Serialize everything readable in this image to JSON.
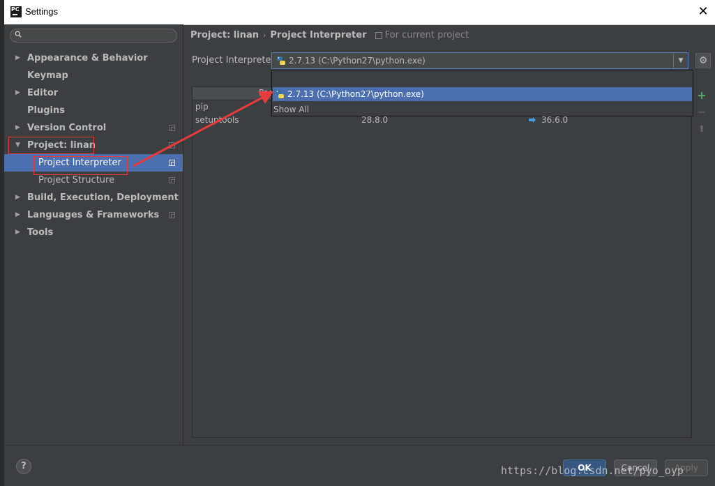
{
  "window": {
    "title": "Settings"
  },
  "sidebar": {
    "search_placeholder": "",
    "items": [
      {
        "label": "Appearance & Behavior",
        "bold": true,
        "arrow": "right"
      },
      {
        "label": "Keymap",
        "bold": true
      },
      {
        "label": "Editor",
        "bold": true,
        "arrow": "right"
      },
      {
        "label": "Plugins",
        "bold": true
      },
      {
        "label": "Version Control",
        "bold": true,
        "arrow": "right"
      },
      {
        "label": "Project: linan",
        "bold": true,
        "arrow": "down"
      },
      {
        "label": "Project Interpreter",
        "child": true,
        "selected": true
      },
      {
        "label": "Project Structure",
        "child": true
      },
      {
        "label": "Build, Execution, Deployment",
        "bold": true,
        "arrow": "right"
      },
      {
        "label": "Languages & Frameworks",
        "bold": true,
        "arrow": "right"
      },
      {
        "label": "Tools",
        "bold": true,
        "arrow": "right"
      }
    ]
  },
  "breadcrumb": {
    "project": "Project: linan",
    "separator": "›",
    "page": "Project Interpreter",
    "hint": "For current project"
  },
  "interpreter": {
    "label": "Project Interpreter:",
    "value": "2.7.13 (C:\\Python27\\python.exe)"
  },
  "packages": {
    "header_partial": "Pac",
    "rows": [
      {
        "name": "pip",
        "version": "",
        "latest": ""
      },
      {
        "name": "setuptools",
        "version": "28.8.0",
        "latest": "36.6.0"
      }
    ]
  },
  "dropdown": {
    "options": [
      "2.7.13 (C:\\Python27\\python.exe)"
    ],
    "show_all": "Show All"
  },
  "footer": {
    "help": "?",
    "ok": "OK",
    "cancel": "Cancel",
    "apply": "Apply"
  },
  "watermark": "https://blog.csdn.net/pyo_oyp",
  "colors": {
    "background": "#3c3f41",
    "selection": "#4b6eaf",
    "annotation": "#e83b3b",
    "add": "#59a869"
  }
}
